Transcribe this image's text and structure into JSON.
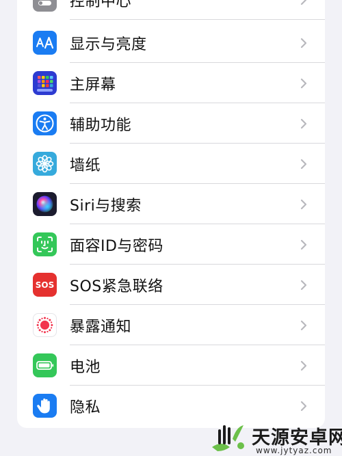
{
  "settings": {
    "items": [
      {
        "label": "控制中心",
        "icon": "control-center-icon",
        "color": "#8e8e93"
      },
      {
        "label": "显示与亮度",
        "icon": "display-brightness-icon",
        "color": "#1a7cf2"
      },
      {
        "label": "主屏幕",
        "icon": "home-screen-icon",
        "color": "#2d3bd1"
      },
      {
        "label": "辅助功能",
        "icon": "accessibility-icon",
        "color": "#1a7cf2"
      },
      {
        "label": "墙纸",
        "icon": "wallpaper-icon",
        "color": "#36aadc"
      },
      {
        "label": "Siri与搜索",
        "icon": "siri-icon",
        "color": "#1b1b2e"
      },
      {
        "label": "面容ID与密码",
        "icon": "face-id-icon",
        "color": "#34c759"
      },
      {
        "label": "SOS紧急联络",
        "icon": "sos-icon",
        "color": "#e5312f",
        "icon_text": "SOS"
      },
      {
        "label": "暴露通知",
        "icon": "exposure-notification-icon",
        "color": "#ffffff"
      },
      {
        "label": "电池",
        "icon": "battery-icon",
        "color": "#34c759"
      },
      {
        "label": "隐私",
        "icon": "privacy-hand-icon",
        "color": "#1a7cf2"
      }
    ]
  },
  "watermark": {
    "title": "天源安卓网",
    "url": "www.jytyaz.com"
  }
}
